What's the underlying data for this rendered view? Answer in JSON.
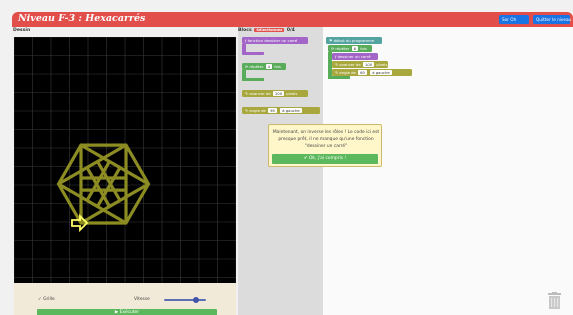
{
  "header": {
    "title": "Niveau F-3 : Hexacarrés",
    "exit_button": "Sor Oh",
    "quit_button": "Quitter le niveau"
  },
  "left": {
    "label": "Dessin",
    "grid_label": "Grille",
    "speed_label": "Vitesse",
    "run_button": "Exécuter",
    "speed_level": 0.75
  },
  "blocks_panel": {
    "label": "Blocs",
    "badge": "Sélectionnez",
    "count": "0/4",
    "items": [
      {
        "prefix": "fonction",
        "text": "dessiner un carré"
      },
      {
        "prefix": "répéter",
        "value": "4",
        "suffix": "fois"
      },
      {
        "prefix": "avancer de",
        "value": "100",
        "suffix": "pixels"
      },
      {
        "prefix": "angle de",
        "value": "90",
        "suffix": "à gauche"
      }
    ]
  },
  "workspace": {
    "start": "début du programme",
    "repeat_prefix": "répéter",
    "repeat_value": "6",
    "repeat_suffix": "fois",
    "call": "dessiner un carré",
    "forward_prefix": "avancer de",
    "forward_value": "100",
    "forward_suffix": "pixels",
    "turn_prefix": "angle de",
    "turn_value": "60",
    "turn_suffix": "à gauche"
  },
  "dialog": {
    "line1": "Maintenant, on inverse les rôles ! Le code ici est",
    "line2": "presque prêt, il ne manque qu'une fonction",
    "line3": "\"dessiner un carré\"",
    "ok_button": "Ok, j'ai compris !"
  },
  "colors": {
    "header": "#e24f4b",
    "shape": "#8c8c23",
    "arrow": "#ffff66",
    "ok": "#5cb85c"
  }
}
